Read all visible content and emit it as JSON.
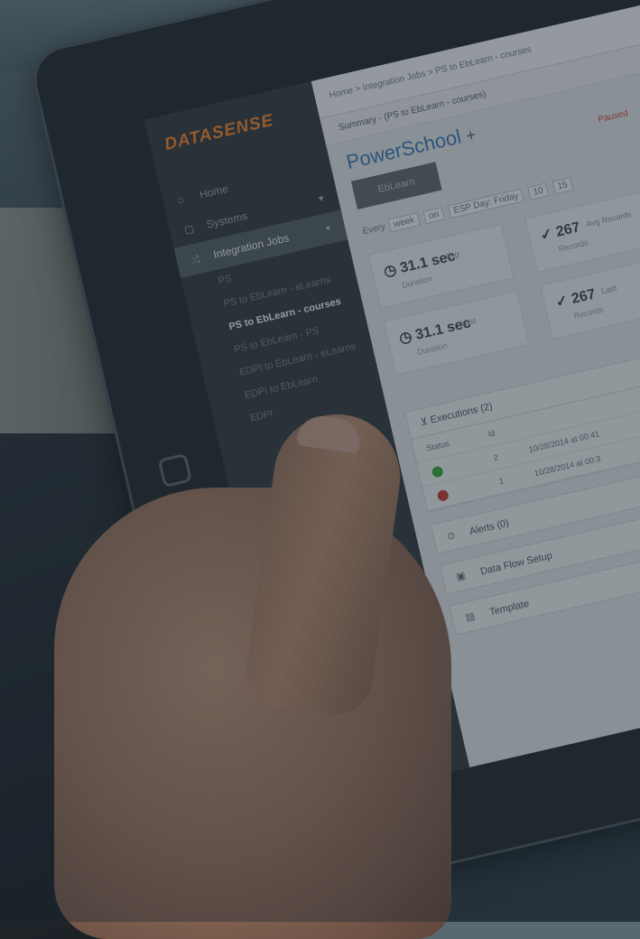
{
  "app": {
    "logo": "DATASENSE"
  },
  "sidebar": {
    "items": [
      {
        "icon": "home-icon",
        "label": "Home"
      },
      {
        "icon": "systems-icon",
        "label": "Systems"
      },
      {
        "icon": "shuffle-icon",
        "label": "Integration Jobs"
      }
    ],
    "group_label": "PS",
    "subitems": [
      {
        "label": "PS to EbLearn - eLearns"
      },
      {
        "label": "PS to EbLearn - courses"
      },
      {
        "label": "PS to EbLearn - PS"
      },
      {
        "label": "EDPI to EbLearn - eLearns"
      },
      {
        "label": "EDPI to EbLearn"
      },
      {
        "label": "EDPI"
      }
    ]
  },
  "main": {
    "breadcrumb": "Home  >  Integration Jobs  >  PS to EbLearn - courses",
    "sub_breadcrumb": "Summary - (PS to EbLearn - courses)",
    "title": "PowerSchool",
    "plus": "+",
    "logo_box_text": "EbLearn",
    "status": "Paused",
    "schedule": {
      "prefix": "Every",
      "chips": [
        "week",
        "on",
        "ESP Day: Friday",
        "10",
        "15"
      ]
    },
    "stats": [
      {
        "value": "31.1 sec",
        "label": "Avg",
        "sub": "Duration"
      },
      {
        "value": "31.1 sec",
        "label": "Last",
        "sub": "Duration"
      },
      {
        "value": "267",
        "label": "Avg Records",
        "sub": "Records"
      },
      {
        "value": "267",
        "label": "Last",
        "sub": "Records"
      }
    ],
    "executions": {
      "header": "Executions (2)",
      "columns": [
        "Status",
        "Id",
        ""
      ],
      "rows": [
        {
          "status": "success",
          "id": "2",
          "date": "10/28/2014 at 00:41"
        },
        {
          "status": "error",
          "id": "1",
          "date": "10/28/2014 at 00:3"
        }
      ]
    },
    "sections": [
      {
        "icon": "alert-icon",
        "label": "Alerts (0)"
      },
      {
        "icon": "flow-icon",
        "label": "Data Flow Setup"
      },
      {
        "icon": "template-icon",
        "label": "Template"
      }
    ]
  },
  "colors": {
    "brand": "#d9792e",
    "title_blue": "#3a6ea5",
    "success": "#3a9a3a",
    "error": "#b33b35"
  }
}
